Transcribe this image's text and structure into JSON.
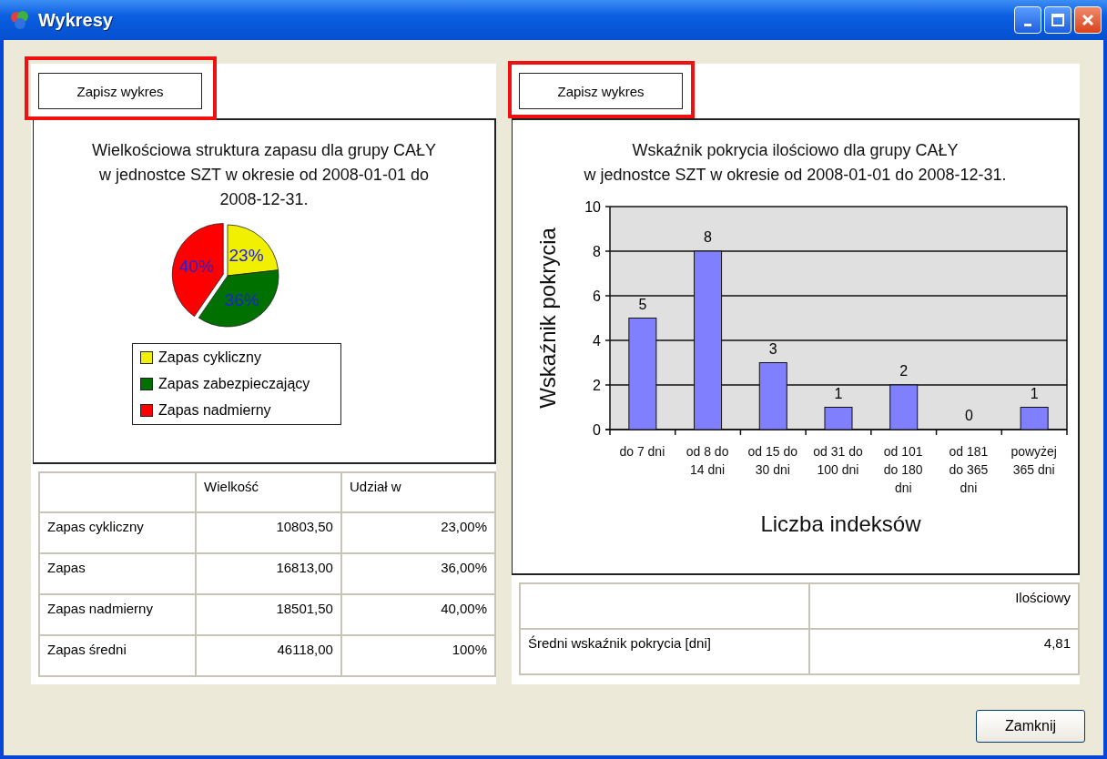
{
  "window": {
    "title": "Wykresy"
  },
  "left_panel": {
    "save_button": {
      "label": "Zapisz wykres",
      "highlighted": true
    },
    "chart": {
      "heading_lines": [
        "Wielkościowa struktura zapasu dla grupy CAŁY",
        "w jednostce SZT w okresie od 2008-01-01 do",
        "2008-12-31."
      ],
      "chart_data": {
        "type": "pie",
        "categories": [
          "Zapas cykliczny",
          "Zapas zabezpieczający",
          "Zapas nadmierny"
        ],
        "values": [
          23,
          36,
          40
        ],
        "value_labels": [
          "23%",
          "36%",
          "40%"
        ]
      },
      "legend": [
        {
          "color": "#f0f000"
        },
        {
          "color": "#007000"
        },
        {
          "color": "#ff0000"
        }
      ]
    },
    "table": {
      "columns": [
        "Wielkość",
        "Udział w"
      ],
      "rows": [
        {
          "label": "Zapas cykliczny",
          "values": [
            "10803,50",
            "23,00%"
          ]
        },
        {
          "label": "Zapas",
          "values": [
            "16813,00",
            "36,00%"
          ]
        },
        {
          "label": "Zapas nadmierny",
          "values": [
            "18501,50",
            "40,00%"
          ]
        },
        {
          "label": "Zapas średni",
          "values": [
            "46118,00",
            "100%"
          ]
        }
      ]
    }
  },
  "right_panel": {
    "save_button": {
      "label": "Zapisz wykres",
      "highlighted": true
    },
    "chart": {
      "heading_lines": [
        "Wskaźnik pokrycia ilościowo dla grupy CAŁY",
        "w jednostce SZT  w okresie od 2008-01-01 do 2008-12-31."
      ],
      "chart_data": {
        "type": "bar",
        "xlabel": "Liczba indeksów",
        "ylabel": "Wskaźnik pokrycia",
        "categories": [
          "do 7 dni",
          "od 8 do 14 dni",
          "od 15 do 30 dni",
          "od 31 do 100 dni",
          "od 101 do 180 dni",
          "od 181 do 365 dni",
          "powyżej 365 dni"
        ],
        "values": [
          5,
          8,
          3,
          1,
          2,
          0,
          1
        ],
        "ylim": [
          0,
          10
        ],
        "yticks": [
          0,
          2,
          4,
          6,
          8,
          10
        ],
        "grid": true,
        "data_labels": true
      }
    },
    "table": {
      "columns": [
        "Ilościowy"
      ],
      "rows": [
        {
          "label": "Średni wskaźnik pokrycia [dni]",
          "values": [
            "4,81"
          ]
        }
      ]
    }
  },
  "close_button": {
    "label": "Zamknij"
  }
}
